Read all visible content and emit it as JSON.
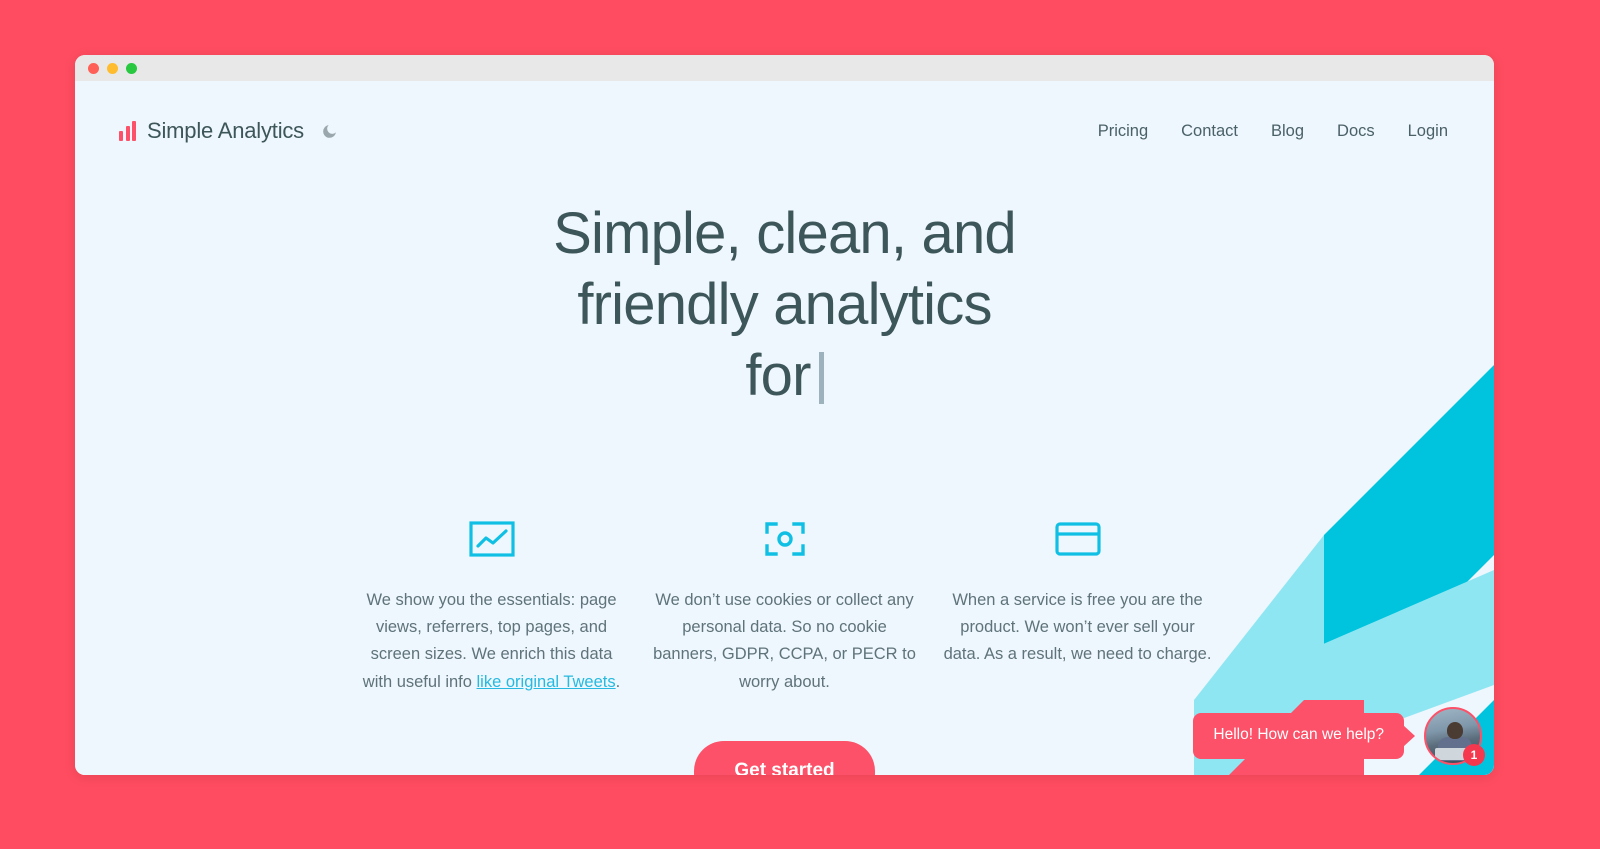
{
  "page": {
    "background_color": "#ff4c60",
    "viewport_background": "#eef7fd"
  },
  "window_controls": {
    "close_label": "close",
    "minimize_label": "minimize",
    "maximize_label": "maximize",
    "close_color": "#ff5f57",
    "minimize_color": "#febc2e",
    "maximize_color": "#28c840"
  },
  "header": {
    "brand_name": "Simple Analytics",
    "logo_icon": "bar-chart-icon",
    "logo_color": "#fc5168",
    "theme_toggle_icon": "moon-icon",
    "nav": [
      {
        "label": "Pricing"
      },
      {
        "label": "Contact"
      },
      {
        "label": "Blog"
      },
      {
        "label": "Docs"
      },
      {
        "label": "Login"
      }
    ]
  },
  "hero": {
    "line1": "Simple, clean, and",
    "line2": "friendly analytics",
    "line3": "for",
    "caret_visible": true,
    "caret_color": "#9cb3bd",
    "heading_color": "#3d5659"
  },
  "features": [
    {
      "icon": "line-chart-icon",
      "text_before_link": "We show you the essentials: page views, referrers, top pages, and screen sizes. We enrich this data with useful info ",
      "link_text": "like original Tweets",
      "text_after_link": "."
    },
    {
      "icon": "focus-target-icon",
      "text_before_link": "We don’t use cookies or collect any personal data. So no cookie banners, GDPR, CCPA, or PECR to worry about.",
      "link_text": "",
      "text_after_link": ""
    },
    {
      "icon": "credit-card-icon",
      "text_before_link": "When a service is free you are the product. We won’t ever sell your data. As a result, we need to charge.",
      "link_text": "",
      "text_after_link": ""
    }
  ],
  "cta": {
    "label": "Get started",
    "color": "#fc5168"
  },
  "chat": {
    "message": "Hello! How can we help?",
    "unread_count": "1",
    "avatar_name": "support-agent-avatar",
    "bubble_color": "#fc5168"
  },
  "decoration": {
    "stripe_color_dark": "#00c4de",
    "stripe_color_light": "#8fe6f3",
    "accent_color": "#fc5168"
  }
}
